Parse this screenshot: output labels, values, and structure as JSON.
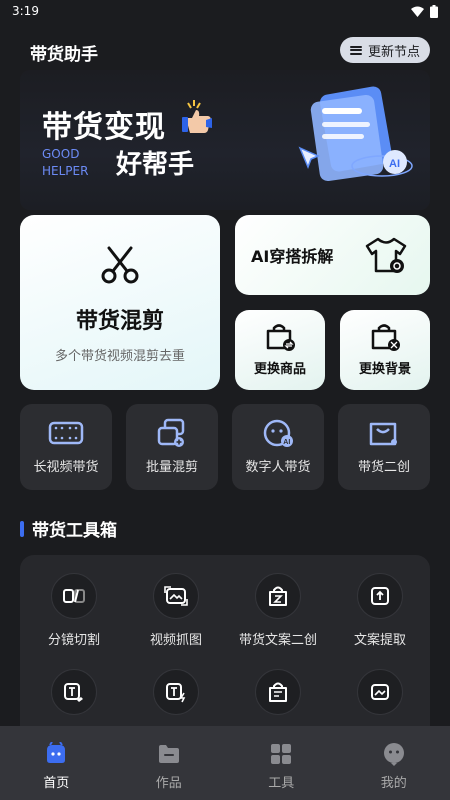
{
  "status": {
    "time": "3:19"
  },
  "header": {
    "title": "带货助手",
    "update_label": "更新节点"
  },
  "banner": {
    "line1": "带货变现",
    "line2": "好帮手",
    "en_line1": "GOOD",
    "en_line2": "HELPER"
  },
  "cards": {
    "mix": {
      "title": "带货混剪",
      "subtitle": "多个带货视频混剪去重"
    },
    "ai_outfit": {
      "title": "AI穿搭拆解"
    },
    "replace_product": {
      "title": "更换商品"
    },
    "replace_bg": {
      "title": "更换背景"
    }
  },
  "features": [
    {
      "label": "长视频带货",
      "icon": "film-icon"
    },
    {
      "label": "批量混剪",
      "icon": "batch-icon"
    },
    {
      "label": "数字人带货",
      "icon": "digital-human-icon"
    },
    {
      "label": "带货二创",
      "icon": "bag-create-icon"
    }
  ],
  "toolbox": {
    "title": "带货工具箱",
    "tools": [
      {
        "label": "分镜切割",
        "icon": "split-icon"
      },
      {
        "label": "视频抓图",
        "icon": "capture-icon"
      },
      {
        "label": "带货文案二创",
        "icon": "bag-text-icon"
      },
      {
        "label": "文案提取",
        "icon": "extract-icon"
      },
      {
        "label": "",
        "icon": "text-rewrite-icon"
      },
      {
        "label": "",
        "icon": "text-flash-icon"
      },
      {
        "label": "",
        "icon": "bag-list-icon"
      },
      {
        "label": "",
        "icon": "image-icon"
      }
    ]
  },
  "tabs": [
    {
      "label": "首页",
      "icon": "home-icon",
      "active": true
    },
    {
      "label": "作品",
      "icon": "folder-icon",
      "active": false
    },
    {
      "label": "工具",
      "icon": "grid-icon",
      "active": false
    },
    {
      "label": "我的",
      "icon": "profile-icon",
      "active": false
    }
  ],
  "colors": {
    "accent": "#3c6df0",
    "background": "#1b1c1f",
    "card_bg": "#2c2d31"
  }
}
